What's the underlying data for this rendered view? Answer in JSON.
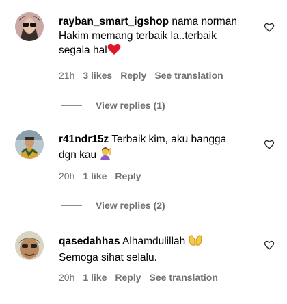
{
  "comments": [
    {
      "username": "rayban_smart_igshop",
      "text_line1": " nama norman",
      "text_line2": "Hakim memang terbaik la..terbaik",
      "text_line3": "segala hal",
      "emoji": "red-heart",
      "time": "21h",
      "likes": "3 likes",
      "reply": "Reply",
      "translate": "See translation",
      "view_replies": "View replies (1)"
    },
    {
      "username": "r41ndr15z",
      "text_line1": " Terbaik kim, aku bangga",
      "text_line2": "dgn kau",
      "emoji": "person-raising-hand",
      "time": "20h",
      "likes": "1 like",
      "reply": "Reply",
      "view_replies": "View replies (2)"
    },
    {
      "username": "qasedahhas",
      "text_line1": " Alhamdulillah",
      "text_line2": "Semoga sihat selalu.",
      "emoji": "open-hands",
      "time": "20h",
      "likes": "1 like",
      "reply": "Reply",
      "translate": "See translation"
    }
  ],
  "colors": {
    "meta_text": "#737373",
    "heart_icon": "#262626"
  }
}
